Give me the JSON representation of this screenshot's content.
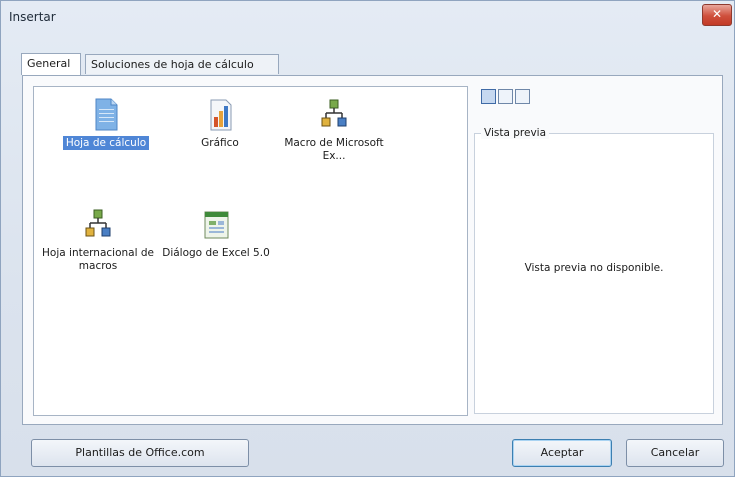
{
  "window": {
    "title": "Insertar",
    "close_glyph": "✕"
  },
  "tabs": [
    {
      "label": "General",
      "active": true
    },
    {
      "label": "Soluciones de hoja de cálculo",
      "active": false
    }
  ],
  "items": [
    {
      "label": "Hoja de cálculo",
      "icon": "worksheet-icon",
      "selected": true
    },
    {
      "label": "Gráfico",
      "icon": "chart-icon",
      "selected": false
    },
    {
      "label": "Macro de Microsoft Ex...",
      "icon": "macro-icon",
      "selected": false
    },
    {
      "label": "Hoja internacional de macros",
      "icon": "macro-icon",
      "selected": false
    },
    {
      "label": "Diálogo de Excel 5.0",
      "icon": "dialog-icon",
      "selected": false
    }
  ],
  "view_buttons": [
    "large-icons-view",
    "list-view",
    "details-view"
  ],
  "preview": {
    "label": "Vista previa",
    "message": "Vista previa no disponible."
  },
  "buttons": {
    "templates": "Plantillas de Office.com",
    "ok": "Aceptar",
    "cancel": "Cancelar"
  }
}
